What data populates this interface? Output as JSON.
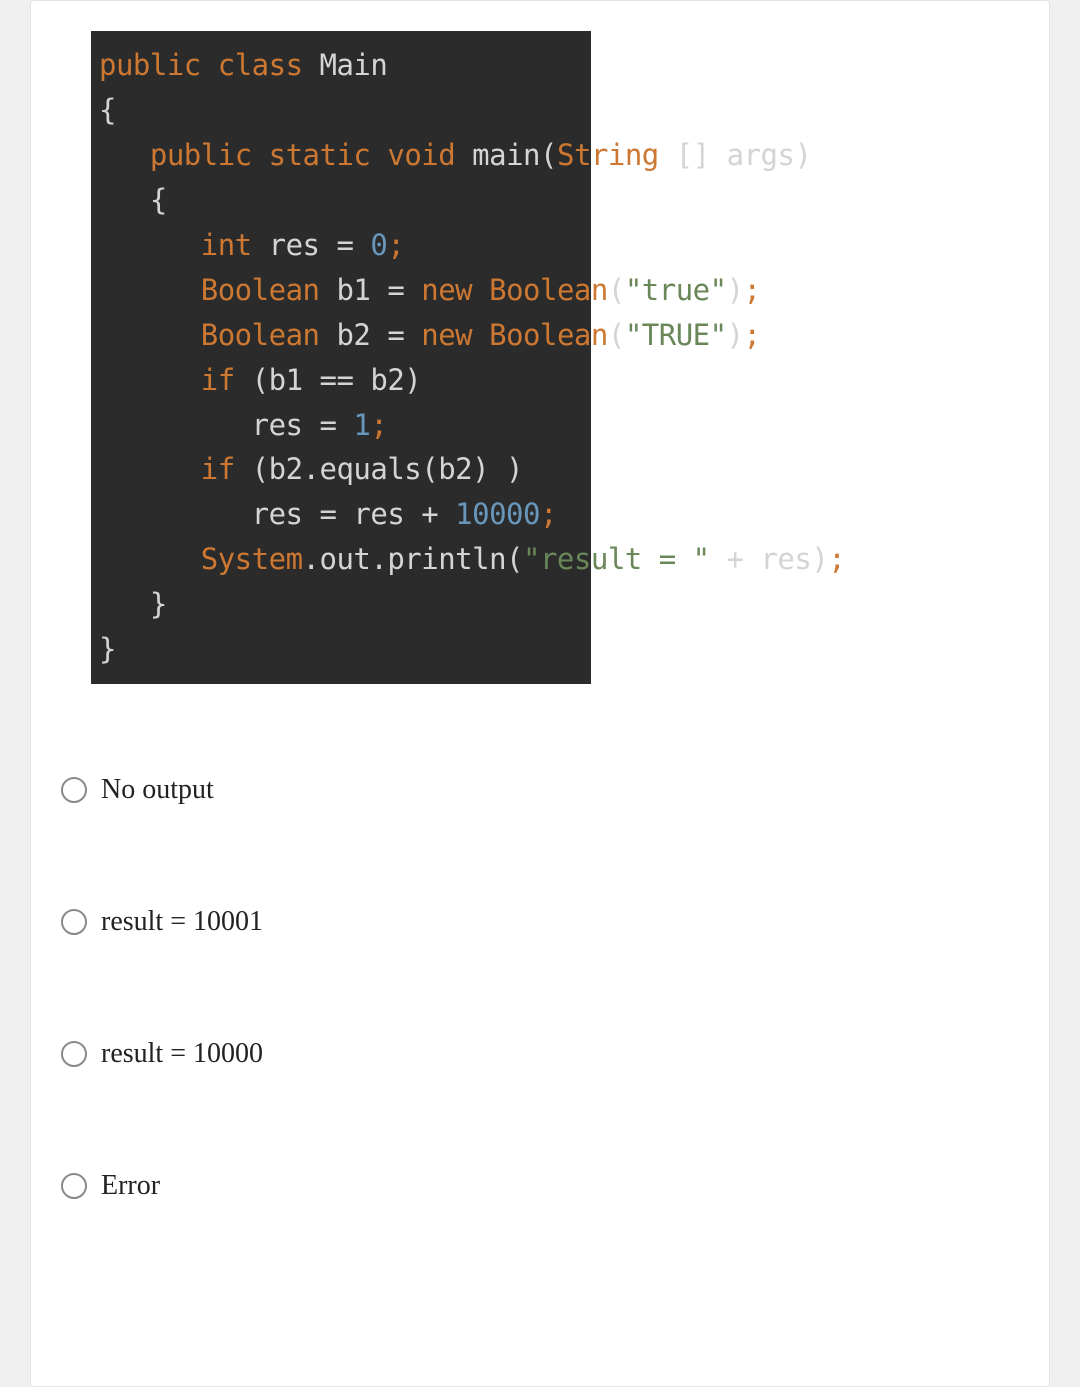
{
  "code": {
    "line1_kw1": "public",
    "line1_kw2": "class",
    "line1_name": "Main",
    "line2_brace": "{",
    "line3_kw1": "public",
    "line3_kw2": "static",
    "line3_kw3": "void",
    "line3_method": "main",
    "line3_paren1": "(",
    "line3_type": "String",
    "line3_arr": "[]",
    "line3_arg": "args",
    "line3_paren2": ")",
    "line4_brace": "{",
    "line5_type": "int",
    "line5_var": "res",
    "line5_eq": " = ",
    "line5_num": "0",
    "line5_semi": ";",
    "line6_type": "Boolean",
    "line6_var": "b1",
    "line6_eq": " = ",
    "line6_new": "new",
    "line6_class": "Boolean",
    "line6_paren1": "(",
    "line6_str": "\"true\"",
    "line6_paren2": ")",
    "line6_semi": ";",
    "line7_type": "Boolean",
    "line7_var": "b2",
    "line7_eq": " = ",
    "line7_new": "new",
    "line7_class": "Boolean",
    "line7_paren1": "(",
    "line7_str": "\"TRUE\"",
    "line7_paren2": ")",
    "line7_semi": ";",
    "line8_if": "if",
    "line8_cond": " (b1 == b2)",
    "line9_var": "res",
    "line9_eq": " = ",
    "line9_num": "1",
    "line9_semi": ";",
    "line10_if": "if",
    "line10_cond": " (b2.equals(b2) )",
    "line11_var": "res",
    "line11_eq": " = res + ",
    "line11_num": "10000",
    "line11_semi": ";",
    "line12_sys": "System",
    "line12_out": ".out.println(",
    "line12_str": "\"result = \"",
    "line12_plus": " + res)",
    "line12_semi": ";",
    "line13_brace": "}",
    "line14_brace": "}"
  },
  "options": [
    {
      "label": "No output"
    },
    {
      "label": "result = 10001"
    },
    {
      "label": "result = 10000"
    },
    {
      "label": "Error"
    }
  ]
}
